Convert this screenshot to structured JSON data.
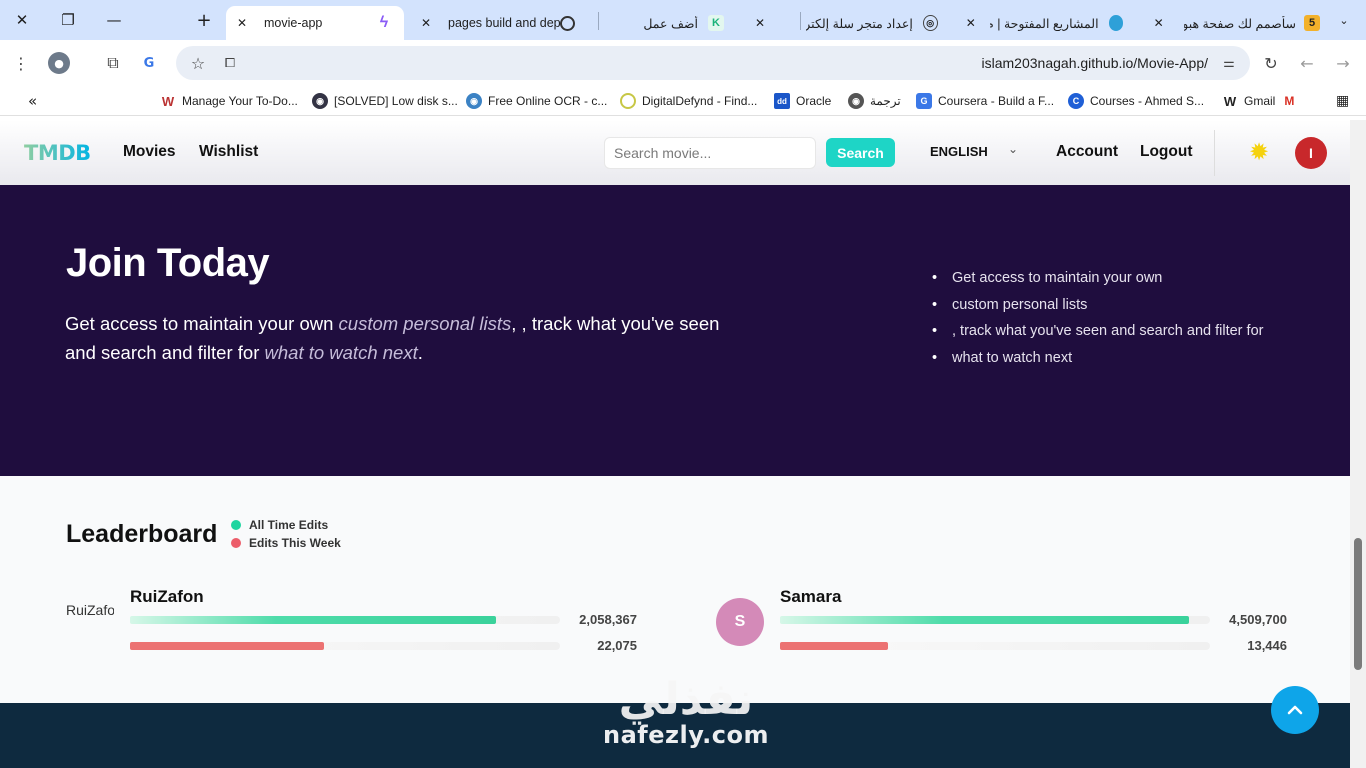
{
  "browser": {
    "tabs": [
      {
        "title": "movie-app",
        "active": true
      },
      {
        "title": "pages build and depl",
        "active": false
      },
      {
        "title": "أضف عمل",
        "active": false
      },
      {
        "title": "إعداد متجر سلة إلكترو",
        "active": false
      },
      {
        "title": "المشاريع المفتوحة | م",
        "active": false
      },
      {
        "title": "سأصمم لك صفحة هبو",
        "active": false
      }
    ],
    "new_tab_label": "+",
    "url": "islam203nagah.github.io/Movie-App/",
    "bookmarks": [
      "Manage Your To-Do...",
      "[SOLVED] Low disk s...",
      "Free Online OCR - c...",
      "DigitalDefynd - Find...",
      "Oracle",
      "ترجمة",
      "Coursera - Build a F...",
      "Courses - Ahmed S...",
      "Gmail"
    ]
  },
  "navbar": {
    "logo": "TMDB",
    "links": [
      "Movies",
      "Wishlist"
    ],
    "search_placeholder": "Search movie...",
    "search_button": "Search",
    "language": "ENGLISH",
    "account": "Account",
    "logout": "Logout",
    "user_initial": "I"
  },
  "join": {
    "title": "Join Today",
    "lead_prefix": "Get access to maintain your own ",
    "lead_em1": "custom personal lists",
    "lead_middle": ", , track what you've seen and search and filter for ",
    "lead_em2": "what to watch next",
    "lead_suffix": ".",
    "bullets": [
      "Get access to maintain your own",
      "custom personal lists",
      ", track what you've seen and search and filter for",
      "what to watch next"
    ]
  },
  "leaderboard": {
    "title": "Leaderboard",
    "legend": [
      {
        "label": "All Time Edits",
        "color": "#1ed5a0"
      },
      {
        "label": "Edits This Week",
        "color": "#ec5d6a"
      }
    ],
    "entries": [
      {
        "name": "RuiZafon",
        "avatar_alt": "RuiZafon",
        "all_time": "2,058,367",
        "this_week": "22,075",
        "all_time_fill": 0.85,
        "week_fill": 0.45
      },
      {
        "name": "Samara",
        "avatar_initial": "S",
        "all_time": "4,509,700",
        "this_week": "13,446",
        "all_time_fill": 0.95,
        "week_fill": 0.25
      }
    ]
  },
  "watermark": {
    "arabic": "نفذلي",
    "latin": "nafezly.com"
  }
}
